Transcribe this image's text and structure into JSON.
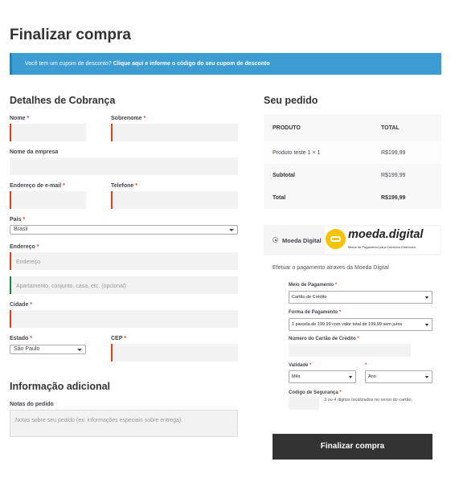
{
  "page": {
    "title": "Finalizar compra"
  },
  "notice": {
    "prefix": "Você tem um cupom de desconto?",
    "link": "Clique aqui e informe o código do seu cupom de desconto"
  },
  "billing": {
    "heading": "Detalhes de Cobrança",
    "nome_label": "Nome",
    "sobrenome_label": "Sobrenome",
    "empresa_label": "Nome da empresa",
    "email_label": "Endereço de e-mail",
    "telefone_label": "Telefone",
    "pais_label": "País",
    "pais_value": "Brasil",
    "endereco_label": "Endereço",
    "endereco_placeholder": "Endereço",
    "complemento_placeholder": "Apartamento, conjunto, casa, etc. (opcional)",
    "cidade_label": "Cidade",
    "estado_label": "Estado",
    "estado_value": "São Paulo",
    "cep_label": "CEP",
    "required_mark": "*"
  },
  "additional": {
    "heading": "Informação adicional",
    "notes_label": "Notas do pedido",
    "notes_placeholder": "Notas sobre seu pedido (ex: informações especiais sobre entrega)."
  },
  "order": {
    "heading": "Seu pedido",
    "col_product": "PRODUTO",
    "col_total": "TOTAL",
    "product_name": "Produto teste 1",
    "product_qty": "× 1",
    "product_total": "R$199,99",
    "subtotal_label": "Subtotal",
    "subtotal_value": "R$199,99",
    "total_label": "Total",
    "total_value": "R$199,99"
  },
  "payment": {
    "method_label": "Moeda Digital",
    "logo_text": "moeda.digital",
    "logo_tagline": "Meios de Pagamento para Comércio Eletrônico",
    "description": "Efetuar o pagamento atraves da Moeda Digital",
    "meio_label": "Meio de Pagamento",
    "meio_value": "Cartão de Crédito",
    "forma_label": "Forma de Pagamento",
    "forma_value": "1 parcela de 199,99 com valor total de 199,99 sem juros",
    "cartao_label": "Número do Cartão de Crédito",
    "validade_label": "Validade",
    "mes_value": "Mês",
    "ano_value": "Ano",
    "codigo_label": "Codigo de Segurança",
    "codigo_help": "3 ou 4 digitos localizados no verso do cartão."
  },
  "actions": {
    "place_order": "Finalizar compra"
  },
  "colors": {
    "notice_bg": "#3d9cd2",
    "required": "#e2401c",
    "button_bg": "#333333",
    "logo_yellow": "#f5c400"
  }
}
